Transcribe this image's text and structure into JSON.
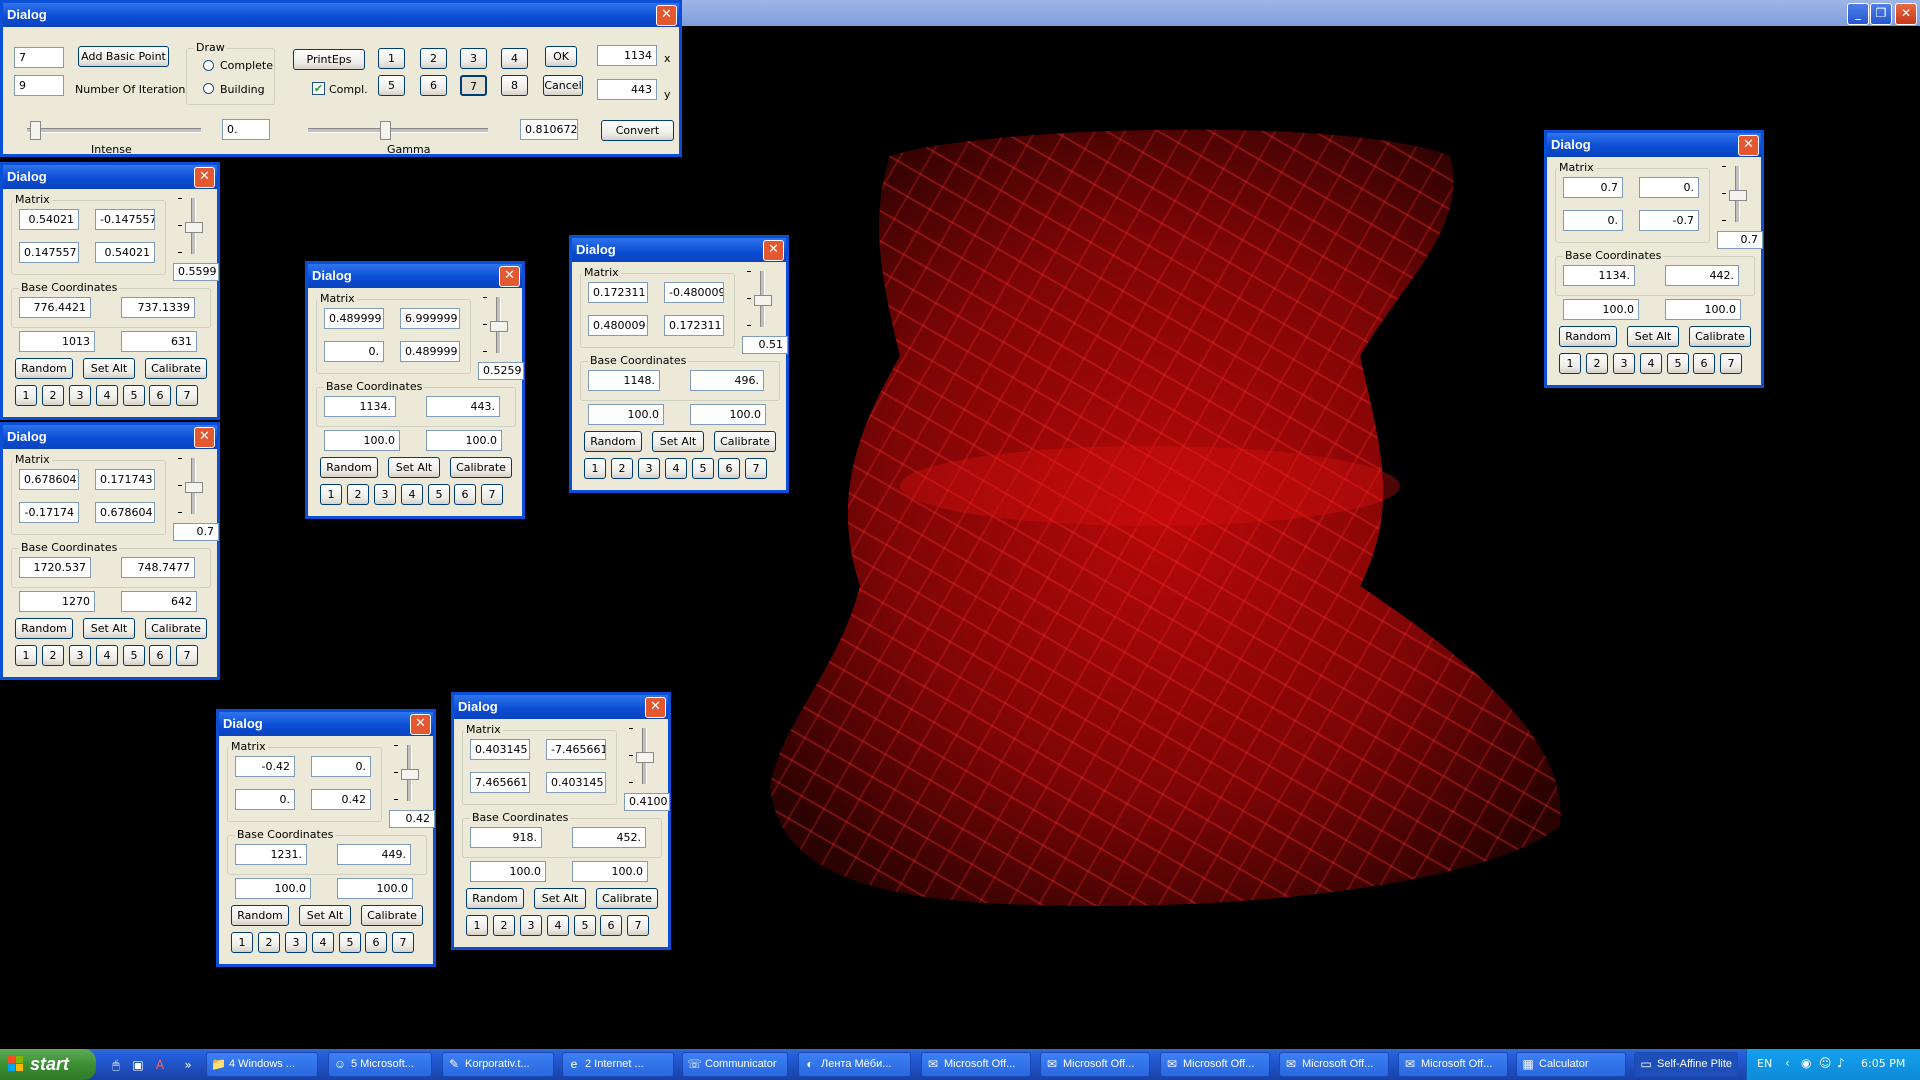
{
  "colors": {
    "title_blue": "#0a4cd2",
    "dialog_bg": "#ece9d8",
    "fractal_red": "#cc0000",
    "desktop": "#000000"
  },
  "main_dialog": {
    "title": "Dialog",
    "basic_points": "7",
    "add_basic_point": "Add Basic Point",
    "iterations": "9",
    "iterations_label": "Number Of Iteration",
    "draw_group": "Draw",
    "draw_complete": "Complete",
    "draw_building": "Building",
    "print_eps": "PrintEps",
    "compl_label": "Compl.",
    "compl_checked": true,
    "number_buttons": [
      "1",
      "2",
      "3",
      "4",
      "5",
      "6",
      "7",
      "8"
    ],
    "selected_number": "7",
    "ok": "OK",
    "cancel": "Cancel",
    "x_value": "1134",
    "x_label": "x",
    "y_value": "443",
    "y_label": "y",
    "intense_value": "0.",
    "intense_label": "Intense",
    "gamma_value": "0.810672",
    "gamma_label": "Gamma",
    "convert": "Convert"
  },
  "dialogs": [
    {
      "title": "Dialog",
      "matrix_label": "Matrix",
      "m": [
        "0.54021",
        "-0.147557",
        "0.147557",
        "0.54021"
      ],
      "scale": "0.5599",
      "base_label": "Base Coordinates",
      "base": [
        "776.4421",
        "737.1339"
      ],
      "v": [
        "1013",
        "631"
      ],
      "random": "Random",
      "setalt": "Set Alt",
      "calibrate": "Calibrate",
      "nums": [
        "1",
        "2",
        "3",
        "4",
        "5",
        "6",
        "7"
      ]
    },
    {
      "title": "Dialog",
      "matrix_label": "Matrix",
      "m": [
        "0.678604",
        "0.171743",
        "-0.17174",
        "0.678604"
      ],
      "scale": "0.7",
      "base_label": "Base Coordinates",
      "base": [
        "1720.537",
        "748.7477"
      ],
      "v": [
        "1270",
        "642"
      ],
      "random": "Random",
      "setalt": "Set Alt",
      "calibrate": "Calibrate",
      "nums": [
        "1",
        "2",
        "3",
        "4",
        "5",
        "6",
        "7"
      ]
    },
    {
      "title": "Dialog",
      "matrix_label": "Matrix",
      "m": [
        "0.489999",
        "6.999999",
        "0.",
        "0.489999"
      ],
      "scale": "0.5259",
      "base_label": "Base Coordinates",
      "base": [
        "1134.",
        "443."
      ],
      "v": [
        "100.0",
        "100.0"
      ],
      "random": "Random",
      "setalt": "Set Alt",
      "calibrate": "Calibrate",
      "nums": [
        "1",
        "2",
        "3",
        "4",
        "5",
        "6",
        "7"
      ]
    },
    {
      "title": "Dialog",
      "matrix_label": "Matrix",
      "m": [
        "0.172311",
        "-0.480009",
        "0.480009",
        "0.172311"
      ],
      "scale": "0.51",
      "base_label": "Base Coordinates",
      "base": [
        "1148.",
        "496."
      ],
      "v": [
        "100.0",
        "100.0"
      ],
      "random": "Random",
      "setalt": "Set Alt",
      "calibrate": "Calibrate",
      "nums": [
        "1",
        "2",
        "3",
        "4",
        "5",
        "6",
        "7"
      ]
    },
    {
      "title": "Dialog",
      "matrix_label": "Matrix",
      "m": [
        "0.7",
        "0.",
        "0.",
        "-0.7"
      ],
      "scale": "0.7",
      "base_label": "Base Coordinates",
      "base": [
        "1134.",
        "442."
      ],
      "v": [
        "100.0",
        "100.0"
      ],
      "random": "Random",
      "setalt": "Set Alt",
      "calibrate": "Calibrate",
      "nums": [
        "1",
        "2",
        "3",
        "4",
        "5",
        "6",
        "7"
      ]
    },
    {
      "title": "Dialog",
      "matrix_label": "Matrix",
      "m": [
        "-0.42",
        "0.",
        "0.",
        "0.42"
      ],
      "scale": "0.42",
      "base_label": "Base Coordinates",
      "base": [
        "1231.",
        "449."
      ],
      "v": [
        "100.0",
        "100.0"
      ],
      "random": "Random",
      "setalt": "Set Alt",
      "calibrate": "Calibrate",
      "nums": [
        "1",
        "2",
        "3",
        "4",
        "5",
        "6",
        "7"
      ]
    },
    {
      "title": "Dialog",
      "matrix_label": "Matrix",
      "m": [
        "0.403145",
        "-7.465661",
        "7.465661",
        "0.403145"
      ],
      "scale": "0.4100",
      "base_label": "Base Coordinates",
      "base": [
        "918.",
        "452."
      ],
      "v": [
        "100.0",
        "100.0"
      ],
      "random": "Random",
      "setalt": "Set Alt",
      "calibrate": "Calibrate",
      "nums": [
        "1",
        "2",
        "3",
        "4",
        "5",
        "6",
        "7"
      ]
    }
  ],
  "taskbar": {
    "start": "start",
    "items": [
      {
        "label": "4 Windows ...",
        "icon": "folder-icon"
      },
      {
        "label": "5 Microsoft...",
        "icon": "messenger-icon"
      },
      {
        "label": "Korporativ.t...",
        "icon": "notepad-icon"
      },
      {
        "label": "2 Internet ...",
        "icon": "ie-icon"
      },
      {
        "label": "Communicator",
        "icon": "communicator-icon"
      },
      {
        "label": "Лента Мёби...",
        "icon": "firefox-icon"
      },
      {
        "label": "Microsoft Off...",
        "icon": "office-icon"
      },
      {
        "label": "Microsoft Off...",
        "icon": "office-icon"
      },
      {
        "label": "Microsoft Off...",
        "icon": "office-icon"
      },
      {
        "label": "Microsoft Off...",
        "icon": "office-icon"
      },
      {
        "label": "Microsoft Off...",
        "icon": "office-icon"
      },
      {
        "label": "Calculator",
        "icon": "calculator-icon"
      },
      {
        "label": "Self-Affine Plite",
        "icon": "window-icon"
      }
    ],
    "lang": "EN",
    "clock": "6:05 PM"
  }
}
